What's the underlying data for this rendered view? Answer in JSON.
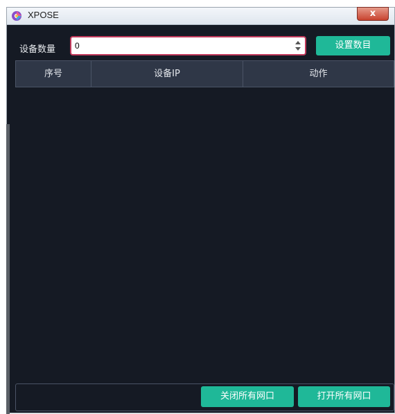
{
  "window": {
    "title": "XPOSE",
    "close_glyph": "x"
  },
  "form": {
    "count_label": "设备数量",
    "count_value": "0",
    "set_button": "设置数目"
  },
  "table": {
    "headers": [
      "序号",
      "设备IP",
      "动作"
    ],
    "rows": []
  },
  "footer": {
    "close_all": "关闭所有网口",
    "open_all": "打开所有网口"
  },
  "colors": {
    "accent": "#1fb898",
    "background": "#151a24",
    "header": "#2f3747",
    "input_border": "#c23a5c"
  }
}
